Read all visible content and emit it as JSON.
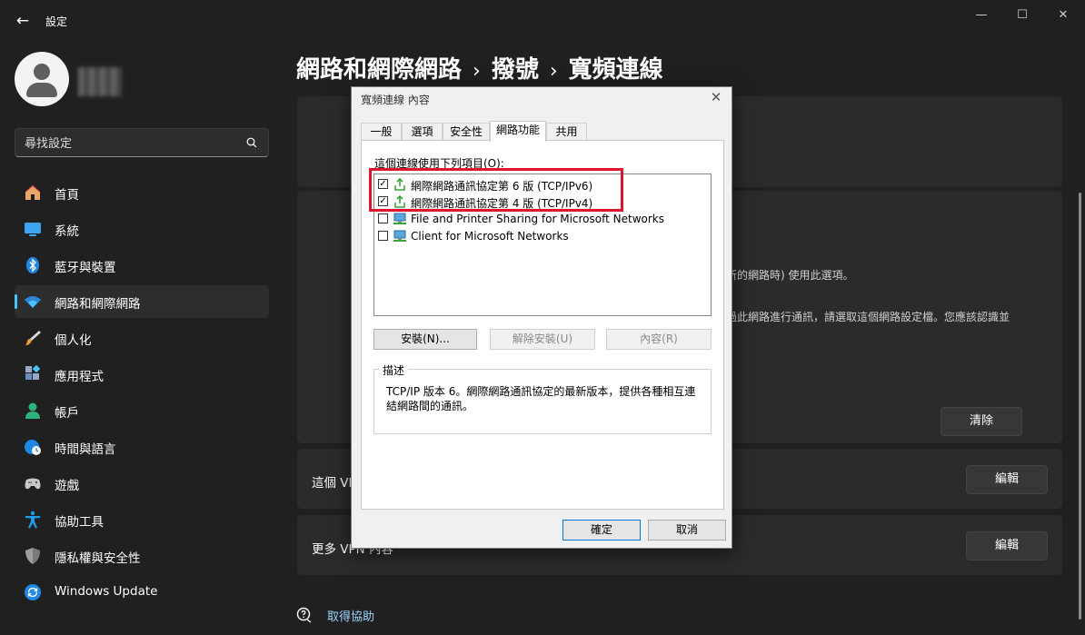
{
  "app": {
    "title": "設定"
  },
  "window_controls": {
    "minimize": "—",
    "maximize": "☐",
    "close": "✕"
  },
  "search": {
    "placeholder": "尋找設定"
  },
  "sidebar": {
    "items": [
      {
        "label": "首頁",
        "icon": "home-icon"
      },
      {
        "label": "系統",
        "icon": "system-icon"
      },
      {
        "label": "藍牙與裝置",
        "icon": "bluetooth-icon"
      },
      {
        "label": "網路和網際網路",
        "icon": "wifi-icon",
        "active": true
      },
      {
        "label": "個人化",
        "icon": "brush-icon"
      },
      {
        "label": "應用程式",
        "icon": "apps-icon"
      },
      {
        "label": "帳戶",
        "icon": "person-icon"
      },
      {
        "label": "時間與語言",
        "icon": "globe-clock-icon"
      },
      {
        "label": "遊戲",
        "icon": "gamepad-icon"
      },
      {
        "label": "協助工具",
        "icon": "accessibility-icon"
      },
      {
        "label": "隱私權與安全性",
        "icon": "shield-icon"
      },
      {
        "label": "Windows Update",
        "icon": "update-icon"
      }
    ]
  },
  "breadcrumb": {
    "part1": "網路和網際網路",
    "sep": "›",
    "part2": "撥號",
    "part3": "寬頻連線"
  },
  "main": {
    "partial_text_1": "場所的網路時) 使用此選項。",
    "partial_text_2": "透過此網路進行通訊，請選取這個網路設定檔。您應該認識並",
    "clear_button": "清除",
    "row_vpn_label": "這個 VPN",
    "row_more_vpn_label": "更多 VPN 內容",
    "edit_button": "編輯",
    "help_link": "取得協助"
  },
  "dialog": {
    "title": "寬頻連線 內容",
    "close": "✕",
    "tabs": [
      "一般",
      "選項",
      "安全性",
      "網路功能",
      "共用"
    ],
    "active_tab": "網路功能",
    "connection_uses_label": "這個連線使用下列項目(O):",
    "items": [
      {
        "label": "網際網路通訊協定第 6 版 (TCP/IPv6)",
        "checked": true,
        "icon": "protocol-icon"
      },
      {
        "label": "網際網路通訊協定第 4 版 (TCP/IPv4)",
        "checked": true,
        "icon": "protocol-icon"
      },
      {
        "label": "File and Printer Sharing for Microsoft Networks",
        "checked": false,
        "icon": "network-service-icon"
      },
      {
        "label": "Client for Microsoft Networks",
        "checked": false,
        "icon": "network-client-icon"
      }
    ],
    "install_button": "安裝(N)...",
    "uninstall_button": "解除安裝(U)",
    "properties_button": "內容(R)",
    "description_title": "描述",
    "description_text": "TCP/IP 版本 6。網際網路通訊協定的最新版本，提供各種相互連結網路間的通訊。",
    "ok_button": "確定",
    "cancel_button": "取消"
  },
  "colors": {
    "accent": "#4cc2ff",
    "highlight_box": "#e0152d",
    "link": "#99d5ff"
  }
}
